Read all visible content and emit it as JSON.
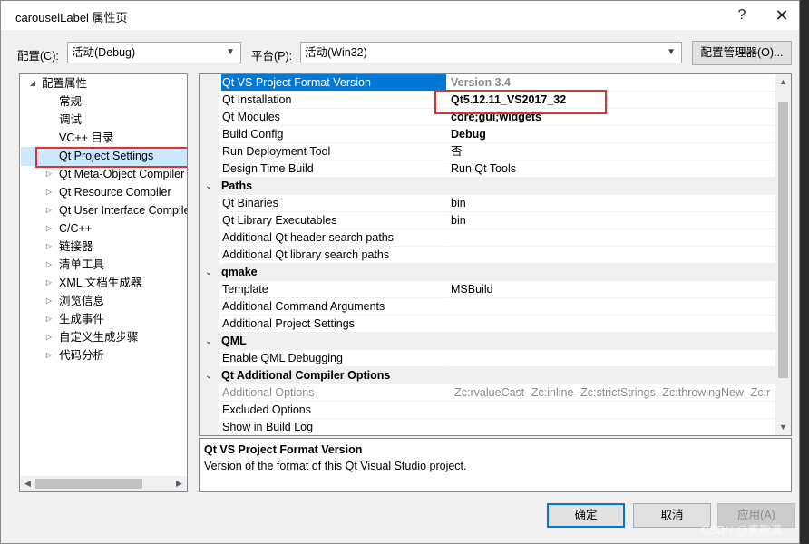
{
  "window": {
    "title": "carouselLabel 属性页",
    "help": "?",
    "close": "✕"
  },
  "toolbar": {
    "config_label": "配置(C):",
    "config_value": "活动(Debug)",
    "platform_label": "平台(P):",
    "platform_value": "活动(Win32)",
    "config_manager": "配置管理器(O)..."
  },
  "tree": {
    "items": [
      {
        "label": "配置属性",
        "twisty": "◢",
        "level": 0
      },
      {
        "label": "常规",
        "twisty": "",
        "level": 1
      },
      {
        "label": "调试",
        "twisty": "",
        "level": 1
      },
      {
        "label": "VC++ 目录",
        "twisty": "",
        "level": 1
      },
      {
        "label": "Qt Project Settings",
        "twisty": "",
        "level": 1,
        "selected": true
      },
      {
        "label": "Qt Meta-Object Compiler",
        "twisty": "▷",
        "level": 1
      },
      {
        "label": "Qt Resource Compiler",
        "twisty": "▷",
        "level": 1
      },
      {
        "label": "Qt User Interface Compiler",
        "twisty": "▷",
        "level": 1
      },
      {
        "label": "C/C++",
        "twisty": "▷",
        "level": 1
      },
      {
        "label": "链接器",
        "twisty": "▷",
        "level": 1
      },
      {
        "label": "清单工具",
        "twisty": "▷",
        "level": 1
      },
      {
        "label": "XML 文档生成器",
        "twisty": "▷",
        "level": 1
      },
      {
        "label": "浏览信息",
        "twisty": "▷",
        "level": 1
      },
      {
        "label": "生成事件",
        "twisty": "▷",
        "level": 1
      },
      {
        "label": "自定义生成步骤",
        "twisty": "▷",
        "level": 1
      },
      {
        "label": "代码分析",
        "twisty": "▷",
        "level": 1
      }
    ]
  },
  "grid": {
    "rows": [
      {
        "type": "prop",
        "name": "Qt VS Project Format Version",
        "value": "Version 3.4",
        "selected": true,
        "bold": true,
        "disabled_value": true
      },
      {
        "type": "prop",
        "name": "Qt Installation",
        "value": "Qt5.12.11_VS2017_32",
        "bold": true
      },
      {
        "type": "prop",
        "name": "Qt Modules",
        "value": "core;gui;widgets",
        "bold": true
      },
      {
        "type": "prop",
        "name": "Build Config",
        "value": "Debug",
        "bold": true
      },
      {
        "type": "prop",
        "name": "Run Deployment Tool",
        "value": "否"
      },
      {
        "type": "prop",
        "name": "Design Time Build",
        "value": "Run Qt Tools"
      },
      {
        "type": "cat",
        "name": "Paths",
        "twisty": "⌄"
      },
      {
        "type": "prop",
        "name": "Qt Binaries",
        "value": "bin"
      },
      {
        "type": "prop",
        "name": "Qt Library Executables",
        "value": "bin"
      },
      {
        "type": "prop",
        "name": "Additional Qt header search paths",
        "value": ""
      },
      {
        "type": "prop",
        "name": "Additional Qt library search paths",
        "value": ""
      },
      {
        "type": "cat",
        "name": "qmake",
        "twisty": "⌄"
      },
      {
        "type": "prop",
        "name": "Template",
        "value": "MSBuild"
      },
      {
        "type": "prop",
        "name": "Additional Command Arguments",
        "value": ""
      },
      {
        "type": "prop",
        "name": "Additional Project Settings",
        "value": ""
      },
      {
        "type": "cat",
        "name": "QML",
        "twisty": "⌄"
      },
      {
        "type": "prop",
        "name": "Enable QML Debugging",
        "value": ""
      },
      {
        "type": "cat",
        "name": "Qt Additional Compiler Options",
        "twisty": "⌄"
      },
      {
        "type": "prop",
        "name": "Additional Options",
        "value": "-Zc:rvalueCast -Zc:inline -Zc:strictStrings -Zc:throwingNew -Zc:r",
        "disabled": true
      },
      {
        "type": "prop",
        "name": "Excluded Options",
        "value": ""
      },
      {
        "type": "prop",
        "name": "Show in Build Log",
        "value": ""
      }
    ]
  },
  "description": {
    "title": "Qt VS Project Format Version",
    "text": "Version of the format of this Qt Visual Studio project."
  },
  "buttons": {
    "ok": "确定",
    "cancel": "取消",
    "apply": "应用(A)"
  },
  "watermark": "CSDN @离歌漠",
  "icons": {
    "scroll_up": "▲",
    "scroll_down": "▼",
    "scroll_left": "◀",
    "scroll_right": "▶",
    "dropdown": "▼"
  }
}
